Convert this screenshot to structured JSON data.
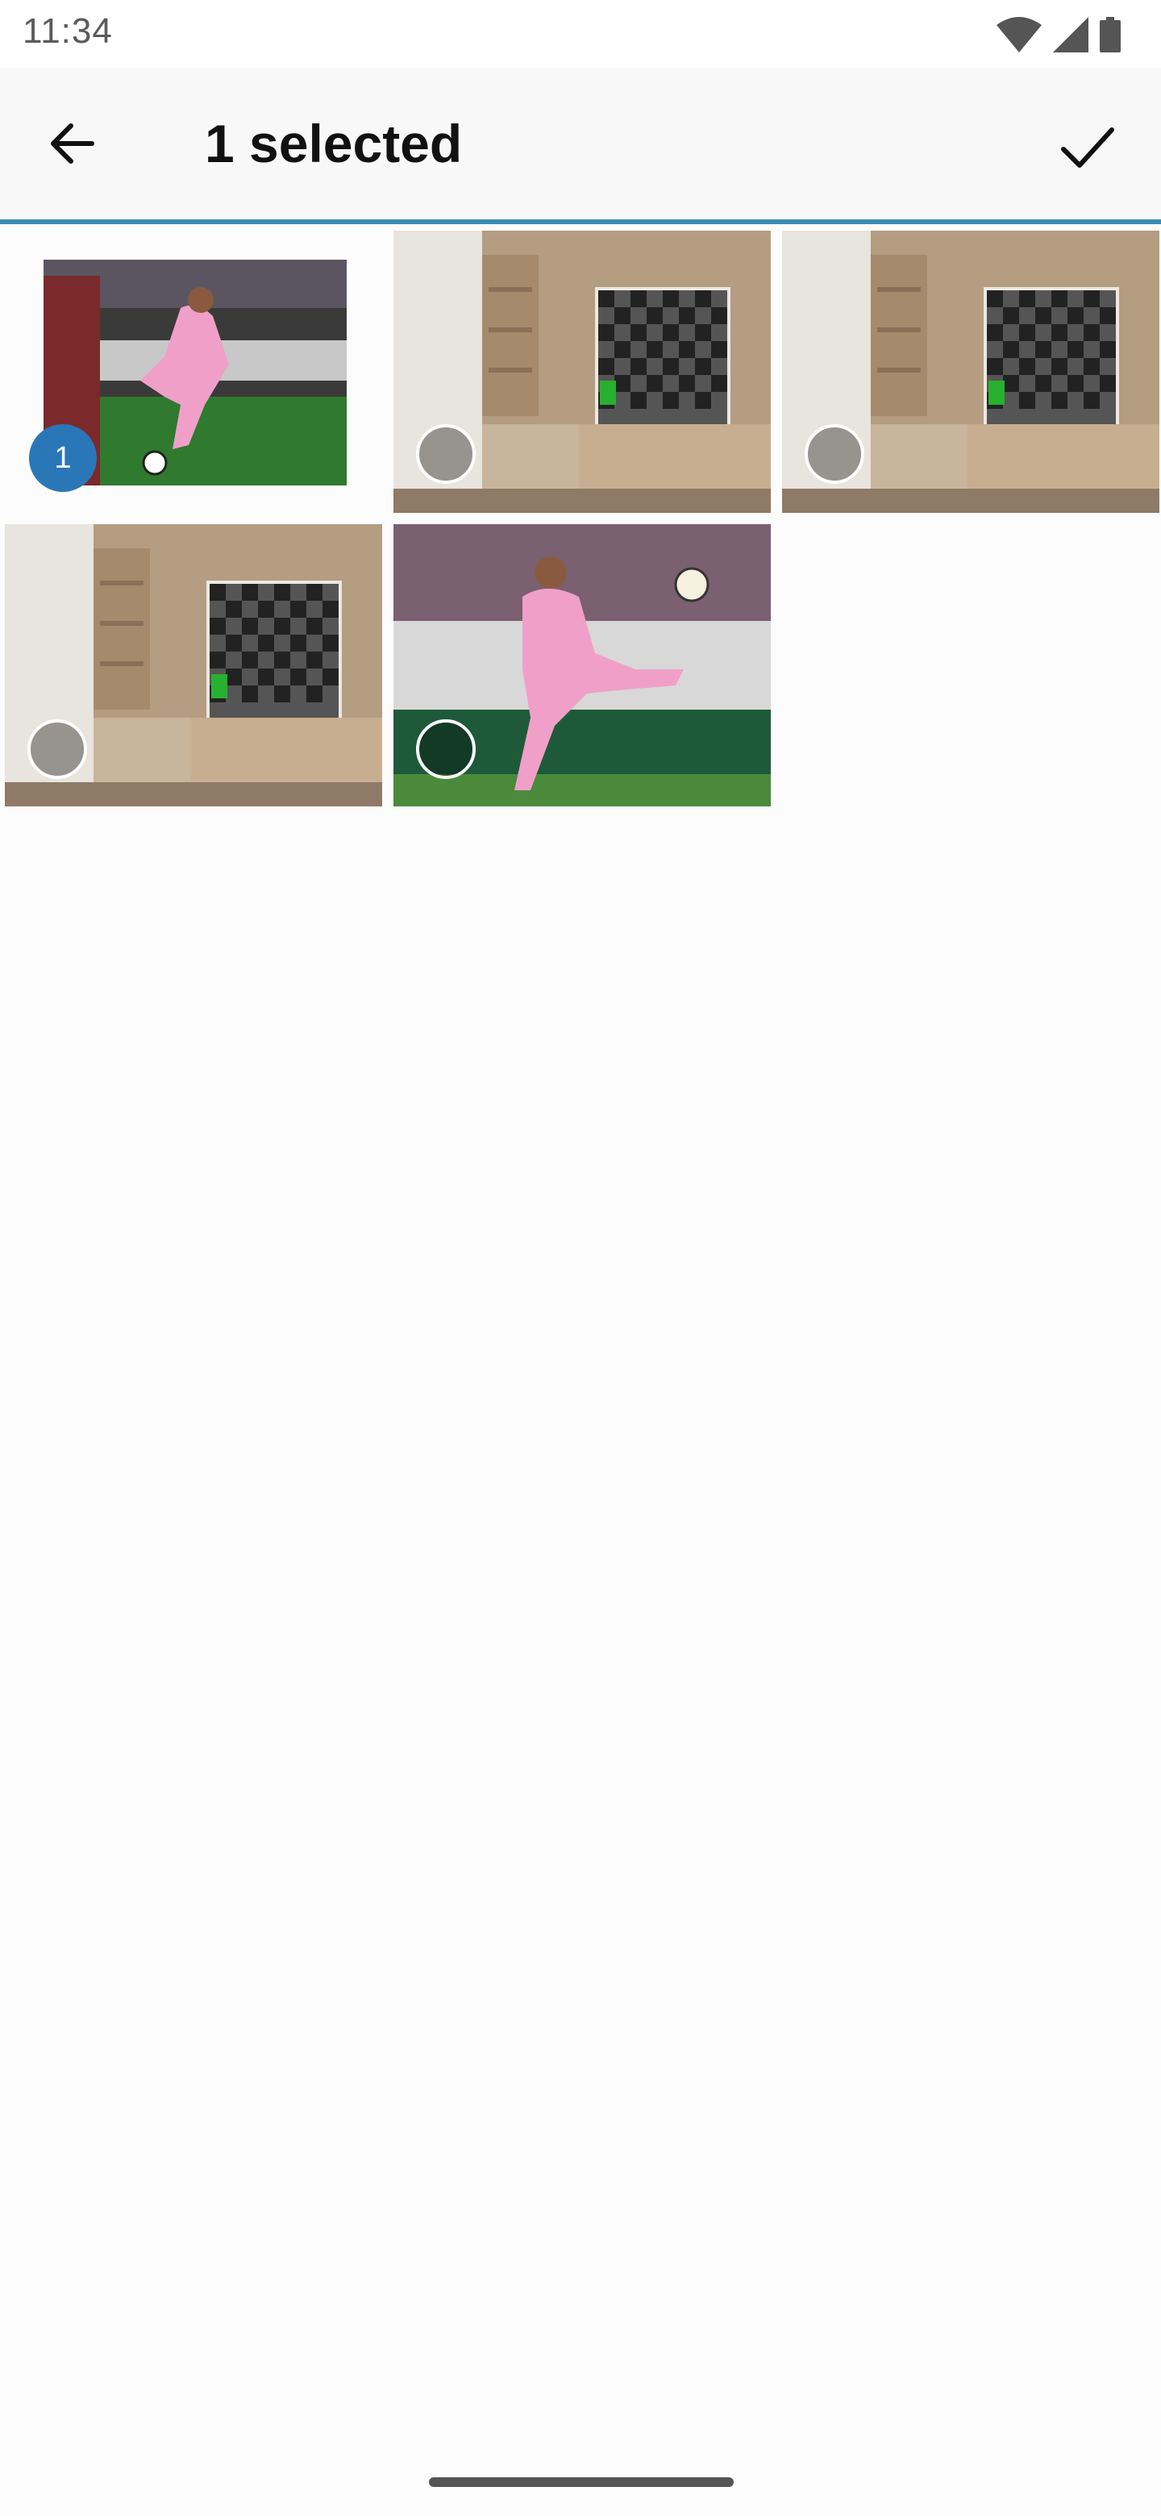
{
  "status_bar": {
    "time": "11:34",
    "icons": [
      "wifi-icon",
      "cellular-signal-icon",
      "battery-icon"
    ]
  },
  "app_bar": {
    "title": "1 selected",
    "back_icon": "arrow-left-icon",
    "confirm_icon": "check-icon",
    "divider_color": "#3a8bb0"
  },
  "grid": {
    "columns": 3,
    "items": [
      {
        "name": "photo-soccer-player-kick",
        "selected": true,
        "selection_order": "1"
      },
      {
        "name": "photo-living-room-tv",
        "selected": false
      },
      {
        "name": "photo-living-room-tv",
        "selected": false
      },
      {
        "name": "photo-living-room-tv",
        "selected": false
      },
      {
        "name": "photo-soccer-player-jump",
        "selected": false
      }
    ]
  },
  "colors": {
    "accent": "#2a77b8",
    "background": "#fdfcfc",
    "app_bar_background": "#f8f8f8"
  }
}
